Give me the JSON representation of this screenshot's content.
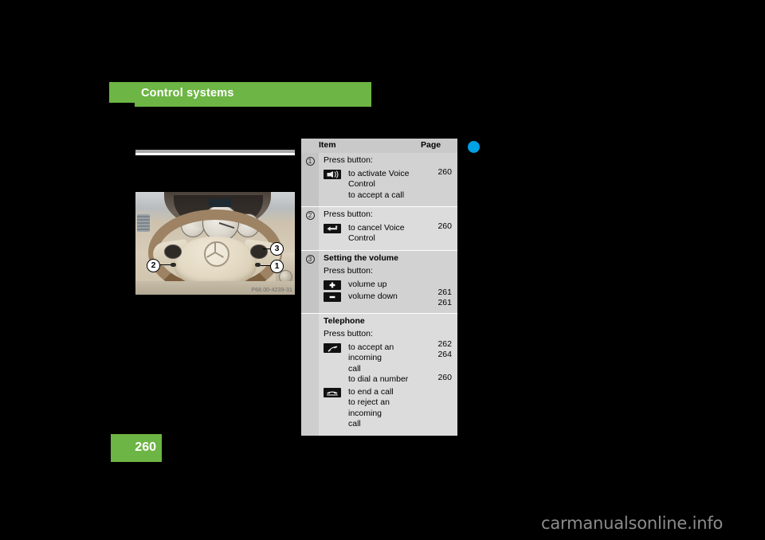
{
  "chapter": {
    "title": "Control systems"
  },
  "page": {
    "number": "260"
  },
  "figure": {
    "caption": "P68.00-4239-31",
    "callouts": [
      {
        "label": "1"
      },
      {
        "label": "2"
      },
      {
        "label": "3"
      }
    ]
  },
  "table": {
    "headers": {
      "item": "Item",
      "page": "Page"
    },
    "rows": [
      {
        "num": "1",
        "lead": "Press button:",
        "icon": "voice-control-icon",
        "lines": [
          "to activate Voice",
          "Control",
          "to accept a call"
        ],
        "pages": [
          "260"
        ]
      },
      {
        "num": "2",
        "lead": "Press button:",
        "icon": "back-arrow-cancel-icon",
        "lines": [
          "to cancel Voice",
          "Control"
        ],
        "pages": [
          "260"
        ]
      },
      {
        "num": "3",
        "head": "Setting the volume",
        "lead": "Press button:",
        "entries": [
          {
            "icon": "plus-icon",
            "lines": [
              "volume up"
            ],
            "page": "261"
          },
          {
            "icon": "minus-icon",
            "lines": [
              "volume down"
            ],
            "page": "261"
          }
        ]
      },
      {
        "num": "",
        "head": "Telephone",
        "lead": "Press button:",
        "entries": [
          {
            "icon": "phone-offhook-accept-icon",
            "lines": [
              "to accept an incoming",
              "call",
              "to dial a number"
            ],
            "pages": [
              "262",
              "264"
            ]
          },
          {
            "icon": "phone-onhook-end-icon",
            "lines": [
              "to end a call",
              "to reject an incoming",
              "call"
            ],
            "pages": [
              "260"
            ]
          }
        ]
      }
    ]
  },
  "watermark": {
    "text": "carmanualsonline.info"
  },
  "marker": {
    "name": "blue-dot-marker",
    "color": "#00a0e4"
  },
  "colors": {
    "brand_green": "#6db544",
    "table_bg": "#d2d2d2",
    "table_alt_bg": "#dcdcdc",
    "table_header_bg": "#c9c9c9"
  }
}
